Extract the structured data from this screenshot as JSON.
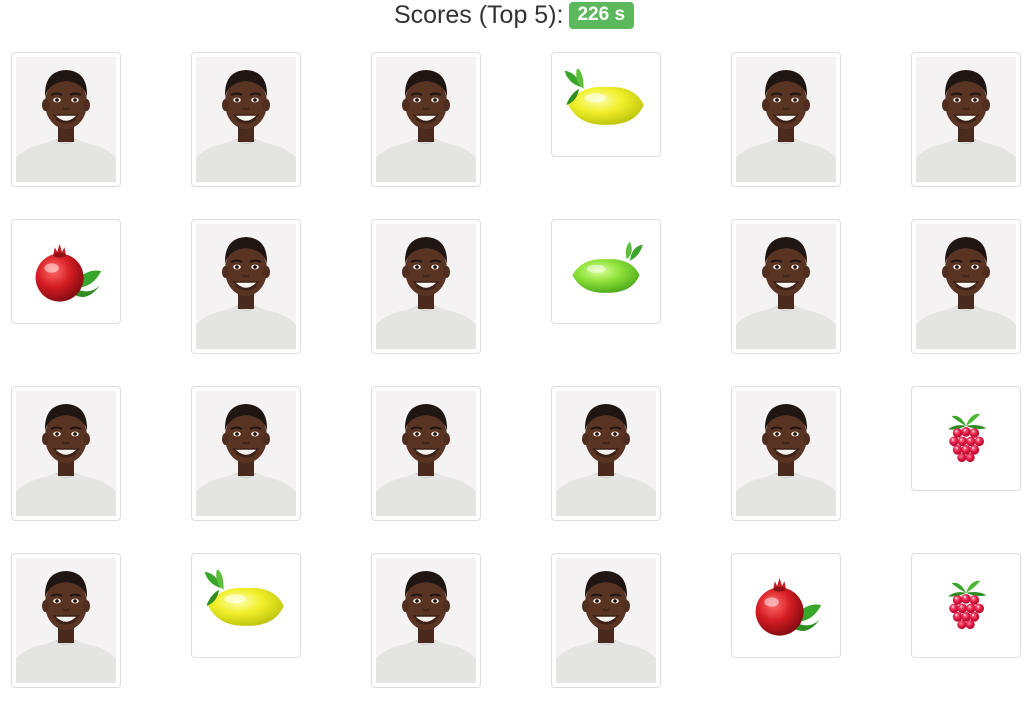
{
  "header": {
    "title": "Scores (Top 5):",
    "score": "226 s"
  },
  "colors": {
    "badge": "#5cb85c",
    "card_border": "#dddddd"
  },
  "board": {
    "rows": [
      [
        "person",
        "person",
        "person",
        "lemon",
        "person",
        "person"
      ],
      [
        "pomegranate",
        "person",
        "person",
        "lime",
        "person",
        "person"
      ],
      [
        "person",
        "person",
        "person",
        "person",
        "person",
        "raspberry"
      ],
      [
        "person",
        "lemon",
        "person",
        "person",
        "pomegranate",
        "raspberry"
      ]
    ]
  }
}
